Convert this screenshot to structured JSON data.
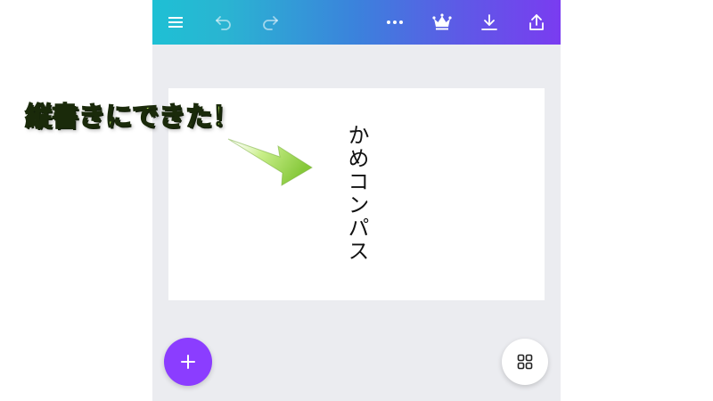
{
  "toolbar": {
    "gradient_start": "#1ec0d4",
    "gradient_end": "#7a3cf0",
    "icons": [
      "menu-icon",
      "undo-icon",
      "redo-icon",
      "more-icon",
      "crown-icon",
      "download-icon",
      "share-icon"
    ]
  },
  "canvas": {
    "text": "かめコンパス",
    "background": "#ffffff"
  },
  "annotation": {
    "text": "縦書きにできた！",
    "color": "#b4e85a"
  },
  "fab": {
    "add_color": "#8b3dff",
    "add_icon": "plus-icon",
    "grid_icon": "grid-icon"
  }
}
